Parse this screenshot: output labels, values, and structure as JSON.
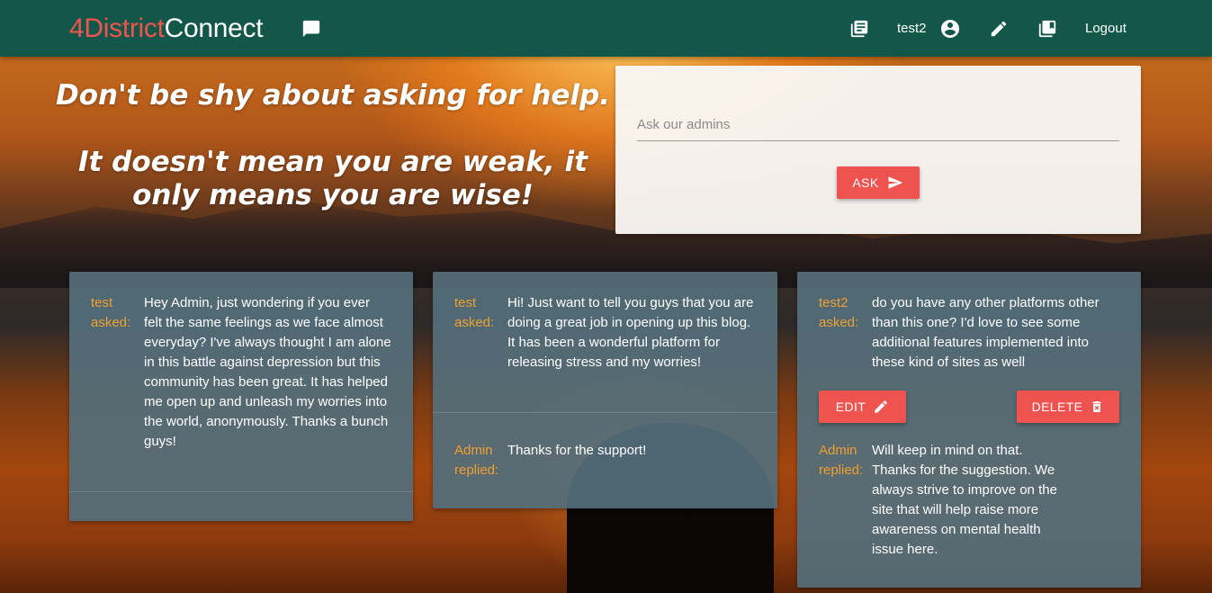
{
  "brand": {
    "part1": "4District",
    "part2": "Connect"
  },
  "nav": {
    "username": "test2",
    "logout": "Logout"
  },
  "quote": {
    "line1": "Don't be shy about asking for help.",
    "line2": "It doesn't mean you are weak, it only means you are wise!"
  },
  "ask": {
    "placeholder": "Ask our admins",
    "button": "ASK"
  },
  "cards": [
    {
      "asker": "test",
      "asked_label": "asked:",
      "question": "Hey Admin, just wondering if you ever felt the same feelings as we face almost everyday? I've always thought I am alone in this battle against depression but this community has been great. It has helped me open up and unleash my worries into the world, anonymously. Thanks a bunch guys!"
    },
    {
      "asker": "test",
      "asked_label": "asked:",
      "question": "Hi! Just want to tell you guys that you are doing a great job in opening up this blog. It has been a wonderful platform for releasing stress and my worries!",
      "replier": "Admin",
      "replied_label": "replied:",
      "reply": "Thanks for the support!"
    },
    {
      "asker": "test2",
      "asked_label": "asked:",
      "question": "do you have any other platforms other than this one? I'd love to see some additional features implemented into these kind of sites as well",
      "edit": "EDIT",
      "delete": "DELETE",
      "replier": "Admin",
      "replied_label": "replied:",
      "reply": "Will keep in mind on that. Thanks for the suggestion. We always strive to improve on the site that will help raise more awareness on mental health issue here."
    }
  ],
  "colors": {
    "navbar": "#13564a",
    "brand_accent": "#f0554d",
    "button": "#ef5350",
    "card": "#546e7a",
    "label": "#f0a030"
  },
  "icons": [
    "chat-icon",
    "library-books-icon",
    "account-circle-icon",
    "pencil-icon",
    "collections-bookmark-icon",
    "send-icon",
    "edit-icon",
    "delete-icon"
  ]
}
